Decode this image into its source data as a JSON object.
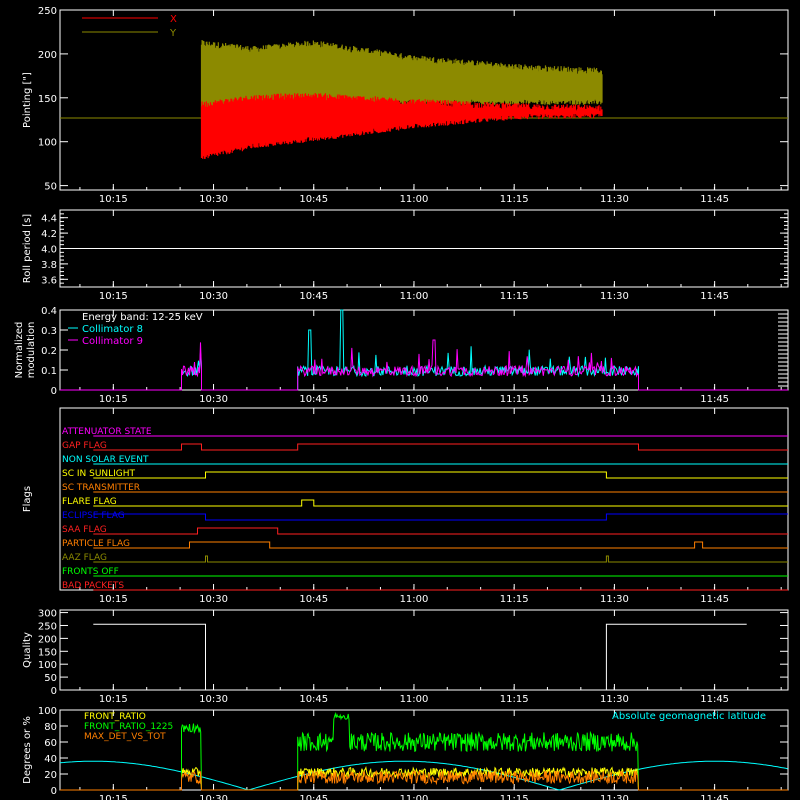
{
  "chart_data": [
    {
      "id": "pointing",
      "type": "line",
      "ylabel": "Pointing [\"]",
      "ylim": [
        45,
        250
      ],
      "yticks": [
        50,
        100,
        150,
        200,
        250
      ],
      "xticks": [
        "10:15",
        "10:30",
        "10:45",
        "11:00",
        "11:15",
        "11:30",
        "11:45"
      ],
      "series": [
        {
          "name": "X",
          "color": "#ff0000",
          "band_x": [
            10.47,
            10.6,
            10.75,
            11.0,
            11.25,
            11.47
          ],
          "band_low": [
            82,
            95,
            103,
            118,
            128,
            130
          ],
          "band_high": [
            142,
            150,
            152,
            145,
            140,
            138
          ]
        },
        {
          "name": "Y",
          "color": "#8c8a00",
          "band_x": [
            10.47,
            10.6,
            10.75,
            11.0,
            11.25,
            11.47
          ],
          "band_low": [
            128,
            135,
            140,
            145,
            145,
            145
          ],
          "band_high": [
            212,
            205,
            212,
            195,
            185,
            180
          ]
        }
      ],
      "baseline": 127
    },
    {
      "id": "roll",
      "type": "line",
      "ylabel": "Roll period [s]",
      "ylim": [
        3.5,
        4.5
      ],
      "yticks": [
        "3.6",
        "3.8",
        "4.0",
        "4.2",
        "4.4"
      ],
      "xticks": [
        "10:15",
        "10:30",
        "10:45",
        "11:00",
        "11:15",
        "11:30",
        "11:45"
      ],
      "value": 4.0
    },
    {
      "id": "modulation",
      "type": "line",
      "ylabel": "Normalized modulation",
      "ylim": [
        0,
        0.4
      ],
      "yticks": [
        "0",
        "0.1",
        "0.2",
        "0.3",
        "0.4"
      ],
      "xticks": [
        "10:15",
        "10:30",
        "10:45",
        "11:00",
        "11:15",
        "11:30",
        "11:45"
      ],
      "annotation": "Energy band: 12-25 keV",
      "series": [
        {
          "name": "Collimator 8",
          "color": "#00ffff"
        },
        {
          "name": "Collimator 9",
          "color": "#ff00ff"
        }
      ],
      "active_segments": [
        [
          10.42,
          10.47
        ],
        [
          10.71,
          11.56
        ]
      ]
    },
    {
      "id": "flags",
      "type": "line",
      "ylabel": "Flags",
      "xticks": [
        "10:15",
        "10:30",
        "10:45",
        "11:00",
        "11:15",
        "11:30",
        "11:45"
      ],
      "flags": [
        {
          "name": "ATTENUATOR STATE",
          "color": "#ff00ff",
          "steps": [
            [
              10.2,
              0
            ],
            [
              11.83,
              0
            ]
          ]
        },
        {
          "name": "GAP FLAG",
          "color": "#ff2020",
          "steps": [
            [
              10.2,
              0
            ],
            [
              10.42,
              1
            ],
            [
              10.47,
              0
            ],
            [
              10.71,
              1
            ],
            [
              11.56,
              0
            ],
            [
              11.83,
              0
            ]
          ]
        },
        {
          "name": "NON SOLAR EVENT",
          "color": "#00ffff",
          "steps": [
            [
              10.2,
              0
            ],
            [
              11.83,
              0
            ]
          ]
        },
        {
          "name": "SC IN SUNLIGHT",
          "color": "#ffff00",
          "steps": [
            [
              10.2,
              0
            ],
            [
              10.48,
              1
            ],
            [
              11.48,
              0
            ],
            [
              11.83,
              0
            ]
          ]
        },
        {
          "name": "SC TRANSMITTER",
          "color": "#ff7f00",
          "steps": [
            [
              10.2,
              0
            ],
            [
              11.83,
              0
            ]
          ]
        },
        {
          "name": "FLARE FLAG",
          "color": "#ffff00",
          "steps": [
            [
              10.2,
              0
            ],
            [
              10.72,
              1
            ],
            [
              10.75,
              0
            ],
            [
              11.83,
              0
            ]
          ]
        },
        {
          "name": "ECLIPSE FLAG",
          "color": "#0000ff",
          "steps": [
            [
              10.2,
              1
            ],
            [
              10.48,
              0
            ],
            [
              11.48,
              1
            ],
            [
              11.83,
              1
            ]
          ]
        },
        {
          "name": "SAA FLAG",
          "color": "#ff2020",
          "steps": [
            [
              10.2,
              0
            ],
            [
              10.46,
              1
            ],
            [
              10.66,
              0
            ],
            [
              11.83,
              0
            ]
          ]
        },
        {
          "name": "PARTICLE FLAG",
          "color": "#ff7f00",
          "steps": [
            [
              10.2,
              0
            ],
            [
              10.44,
              1
            ],
            [
              10.64,
              0
            ],
            [
              11.7,
              0
            ],
            [
              11.7,
              1
            ],
            [
              11.72,
              0
            ],
            [
              11.83,
              0
            ]
          ]
        },
        {
          "name": "AAZ FLAG",
          "color": "#8c8a00",
          "steps": [
            [
              10.2,
              0
            ],
            [
              10.48,
              1
            ],
            [
              10.485,
              0
            ],
            [
              11.48,
              1
            ],
            [
              11.485,
              0
            ],
            [
              11.83,
              0
            ]
          ]
        },
        {
          "name": "FRONTS OFF",
          "color": "#00ff00",
          "steps": [
            [
              10.2,
              0
            ],
            [
              11.83,
              0
            ]
          ]
        },
        {
          "name": "BAD PACKETS",
          "color": "#ff2020",
          "steps": [
            [
              10.2,
              0
            ],
            [
              11.83,
              0
            ]
          ]
        }
      ]
    },
    {
      "id": "quality",
      "type": "line",
      "ylabel": "Quality",
      "ylim": [
        0,
        310
      ],
      "yticks": [
        "0",
        "50",
        "100",
        "150",
        "200",
        "250",
        "300"
      ],
      "xticks": [
        "10:15",
        "10:30",
        "10:45",
        "11:00",
        "11:15",
        "11:30",
        "11:45"
      ],
      "steps": [
        [
          10.2,
          255
        ],
        [
          10.48,
          255
        ],
        [
          10.48,
          0
        ],
        [
          11.48,
          0
        ],
        [
          11.48,
          255
        ],
        [
          11.83,
          255
        ]
      ]
    },
    {
      "id": "degrees",
      "type": "line",
      "ylabel": "Degrees or %",
      "ylim": [
        0,
        100
      ],
      "yticks": [
        "0",
        "20",
        "40",
        "60",
        "80",
        "100"
      ],
      "xticks": [
        "10:15",
        "10:30",
        "10:45",
        "11:00",
        "11:15",
        "11:30",
        "11:45"
      ],
      "annotation": "Absolute geomagnetic latitude",
      "annotation_color": "#00ffff",
      "series": [
        {
          "name": "FRONT_RATIO",
          "color": "#ffff00"
        },
        {
          "name": "FRONT_RATIO_1225",
          "color": "#00ff00"
        },
        {
          "name": "MAX_DET_VS_TOT",
          "color": "#ff7f00"
        }
      ],
      "active_segments": [
        [
          10.42,
          10.47
        ],
        [
          10.71,
          11.56
        ]
      ]
    }
  ],
  "colors": {
    "axes": "#ffffff",
    "background": "#000000"
  }
}
